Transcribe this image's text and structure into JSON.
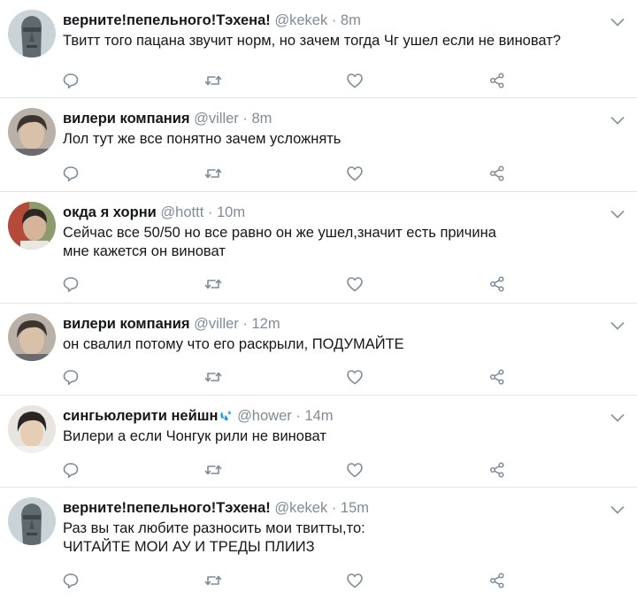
{
  "colors": {
    "text": "#14171a",
    "muted": "#808b96",
    "divider": "#dfe3e6",
    "icon": "#7f8b98",
    "water": "#1fa7e0"
  },
  "tweets": [
    {
      "name": "верните!пепельного!Тэхена!",
      "handle": "@kekek",
      "dot": "·",
      "time": "8m",
      "lines": [
        "Твитт того пацана звучит норм, но зачем тогда Чг ушел если не виноват?"
      ],
      "avatar_icon": "moai-statue",
      "emoji": ""
    },
    {
      "name": "вилери компания",
      "handle": "@viller",
      "dot": "·",
      "time": "8m",
      "lines": [
        "Лол тут же все понятно зачем усложнять"
      ],
      "avatar_icon": "person-photo",
      "emoji": ""
    },
    {
      "name": "окда я хорни",
      "handle": "@hottt",
      "dot": "·",
      "time": "10m",
      "lines": [
        "Сейчас все 50/50 но все равно он же ушел,значит есть причина",
        "мне кажется он виноват"
      ],
      "avatar_icon": "person-photo",
      "emoji": ""
    },
    {
      "name": "вилери компания",
      "handle": "@viller",
      "dot": "·",
      "time": "12m",
      "lines": [
        "он свалил потому что его раскрыли, ПОДУМАЙТЕ"
      ],
      "avatar_icon": "person-photo",
      "emoji": ""
    },
    {
      "name": "сингьюлерити нейшн",
      "handle": "@hower",
      "dot": "·",
      "time": "14m",
      "lines": [
        "Вилери а если Чонгук рили не виноват"
      ],
      "avatar_icon": "person-photo",
      "emoji": "water-droplets"
    },
    {
      "name": "верните!пепельного!Тэхена!",
      "handle": "@kekek",
      "dot": "·",
      "time": "15m",
      "lines": [
        "Раз вы так любите разносить мои твитты,то:",
        "ЧИТАЙТЕ МОИ АУ И ТРЕДЫ ПЛИИЗ"
      ],
      "avatar_icon": "moai-statue",
      "emoji": ""
    }
  ],
  "action_icons": [
    "reply-icon",
    "retweet-icon",
    "like-icon",
    "share-icon"
  ]
}
